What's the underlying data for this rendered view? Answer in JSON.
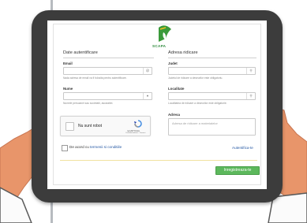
{
  "brand": {
    "name": "SCAPA"
  },
  "left_section": {
    "title": "Date autentificare",
    "email": {
      "label": "Email",
      "hint": "Nada adresa de email va fi folosita pentru autentificare."
    },
    "name": {
      "label": "Nume",
      "hint": "Numele persoanei sau societatii, asociatiei."
    },
    "captcha": {
      "label": "Nu sunt robot",
      "brand": "reCAPTCHA",
      "links": "Confidentialitate - Termeni"
    }
  },
  "right_section": {
    "title": "Adresa ridicare",
    "county": {
      "label": "Judet",
      "hint": "Judetul de ridicare a deseurilor este obligatoriu."
    },
    "city": {
      "label": "Localitate",
      "hint": "Localitatea de ridicare a deseurilor este obligatorie."
    },
    "address": {
      "label": "Adresa",
      "placeholder": "Adresa de ridicare a materialelor"
    }
  },
  "terms": {
    "prefix": "De acord cu ",
    "link": "termenii si conditiile"
  },
  "login_link": "Autentifica-te",
  "submit_label": "Inregistreaza-te",
  "colors": {
    "tablet": "#3c3c3c",
    "submit": "#5cb85c",
    "link": "#2457a3",
    "skin": "#e8956a",
    "sleeve": "#fbfbfb"
  }
}
